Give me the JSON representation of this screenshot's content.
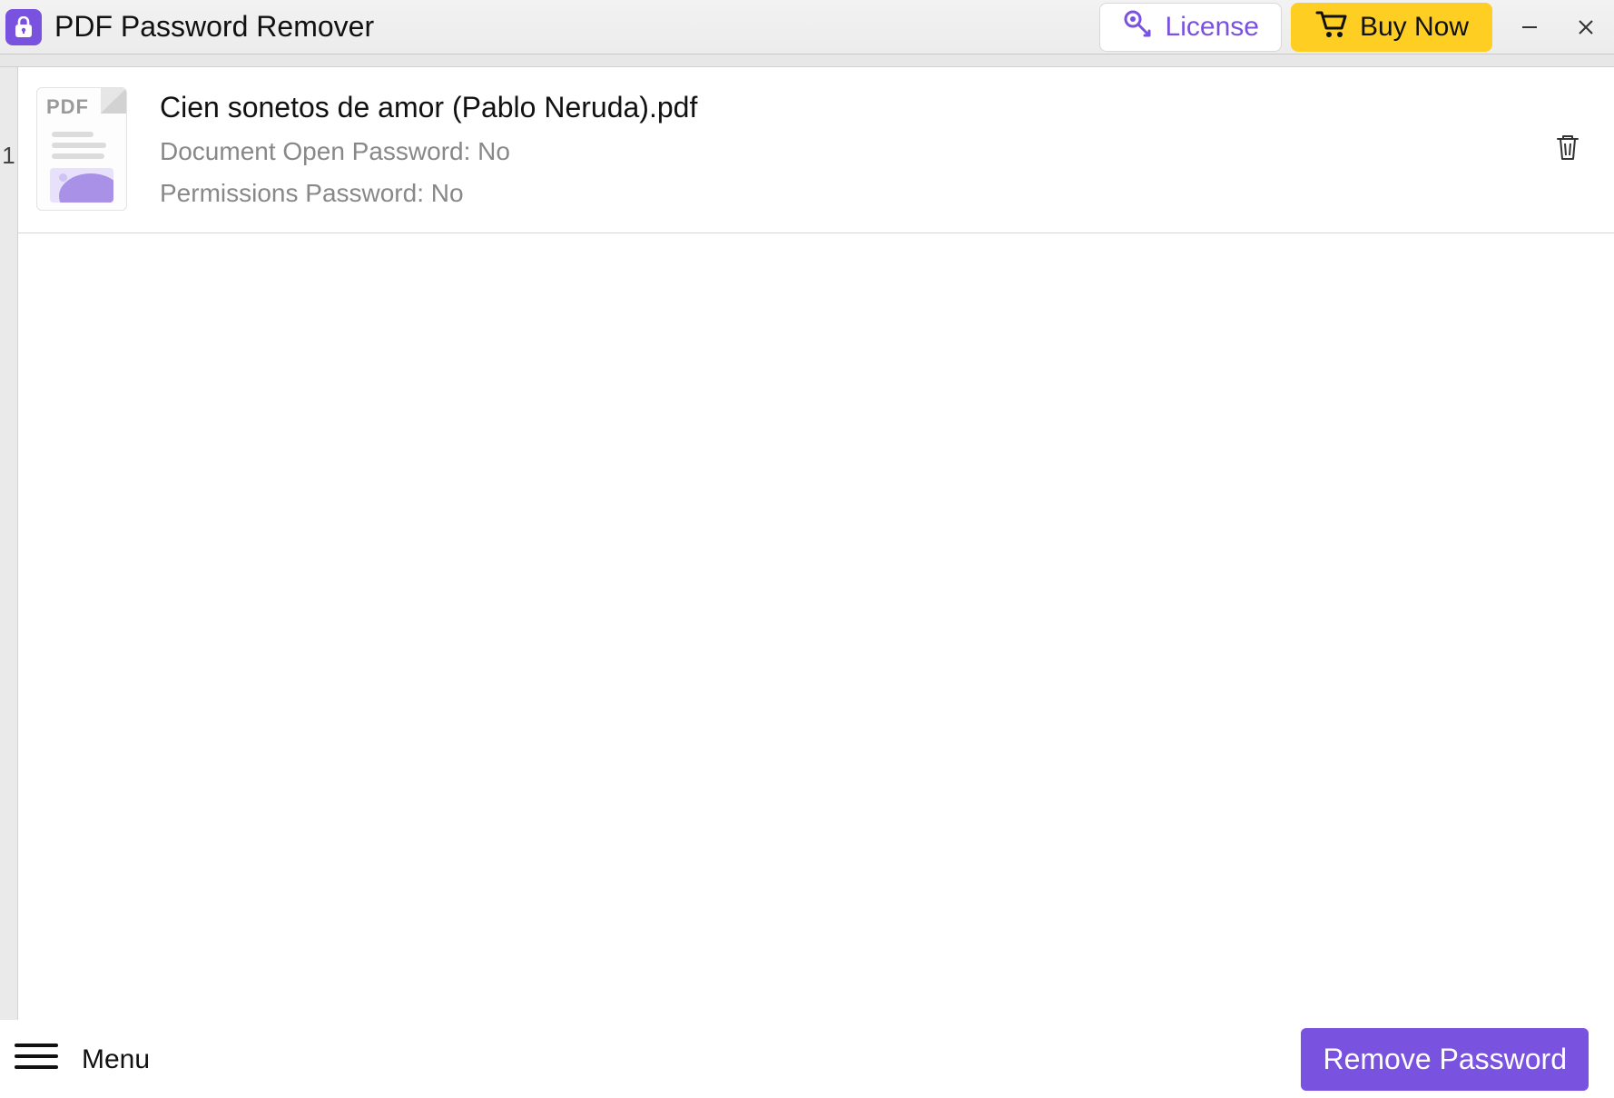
{
  "titlebar": {
    "app_name": "PDF Password Remover",
    "license_label": "License",
    "buy_now_label": "Buy Now"
  },
  "colors": {
    "accent": "#7a52e0",
    "accent_light": "#a991e8",
    "buy_now_bg": "#ffce22"
  },
  "files": [
    {
      "index": "1",
      "name": "Cien sonetos de amor (Pablo Neruda).pdf",
      "doc_open_password": "Document Open Password: No",
      "permissions_password": "Permissions Password: No",
      "thumb_label": "PDF"
    }
  ],
  "bottombar": {
    "menu_label": "Menu",
    "remove_label": "Remove Password"
  }
}
